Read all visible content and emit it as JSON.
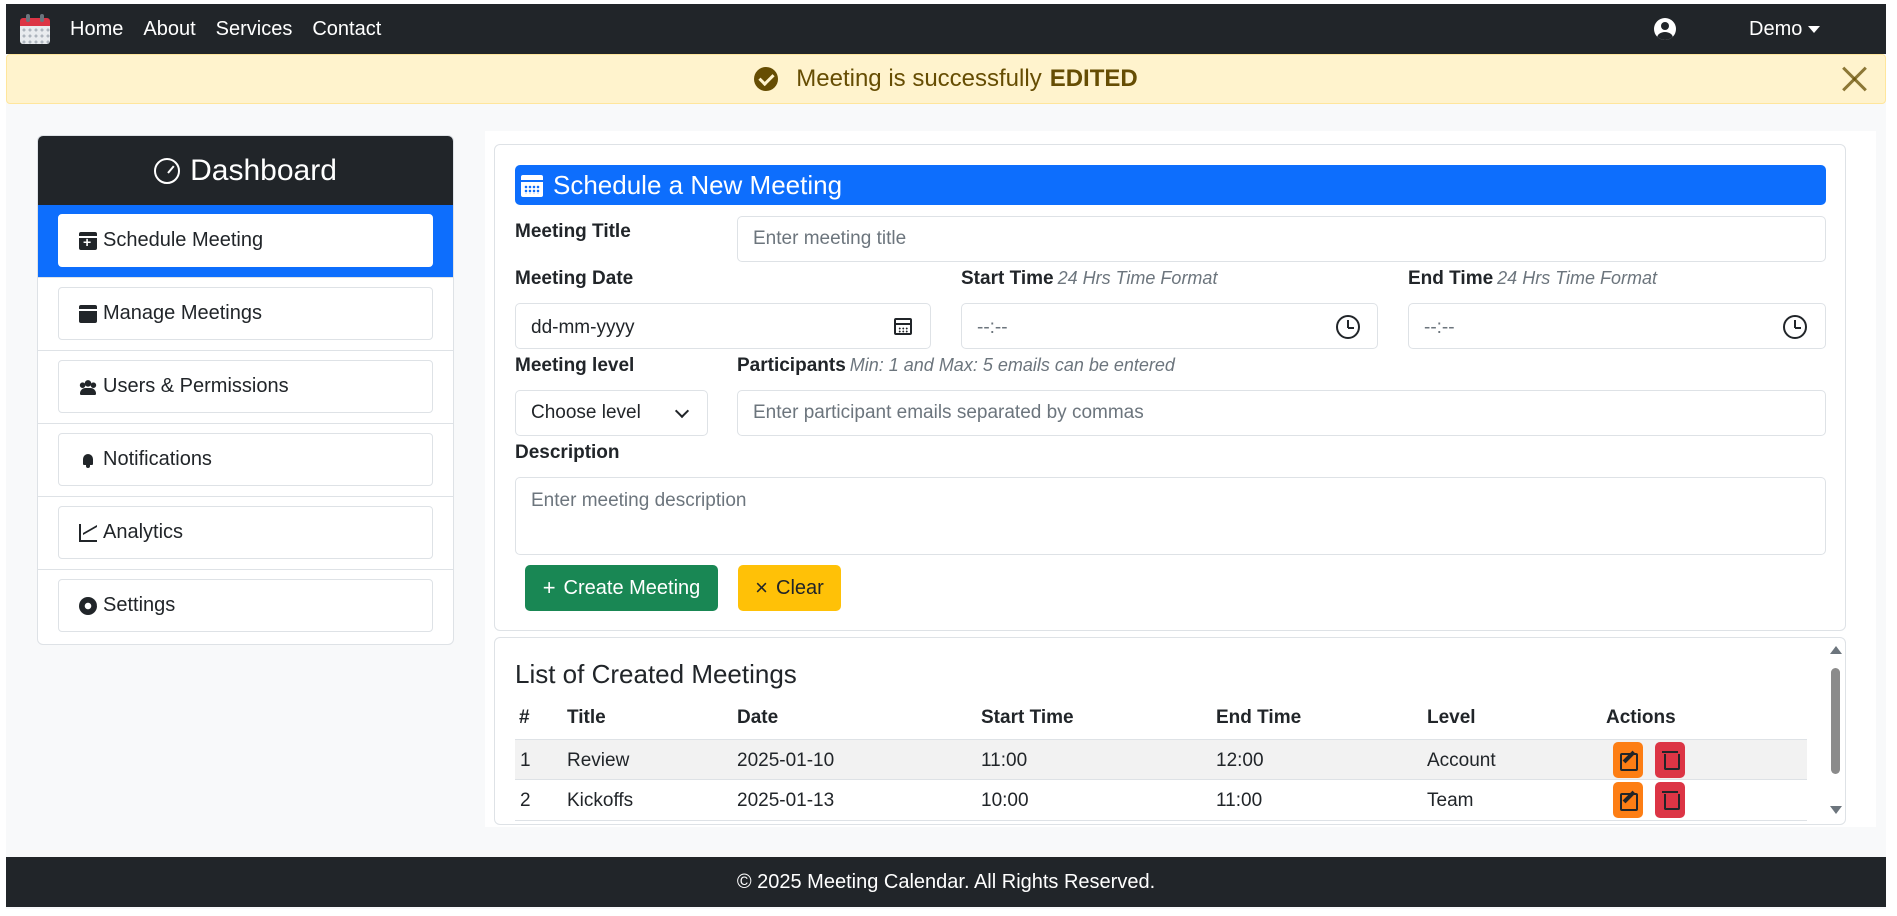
{
  "navbar": {
    "links": [
      "Home",
      "About",
      "Services",
      "Contact"
    ],
    "user_label": "Demo"
  },
  "alert": {
    "message": "Meeting is successfully",
    "emphasis": "EDITED"
  },
  "sidebar": {
    "title": "Dashboard",
    "items": [
      {
        "label": "Schedule Meeting",
        "icon": "calendar-plus-icon",
        "active": true
      },
      {
        "label": "Manage Meetings",
        "icon": "calendar-icon",
        "active": false
      },
      {
        "label": "Users & Permissions",
        "icon": "users-icon",
        "active": false
      },
      {
        "label": "Notifications",
        "icon": "bell-icon",
        "active": false
      },
      {
        "label": "Analytics",
        "icon": "chart-line-icon",
        "active": false
      },
      {
        "label": "Settings",
        "icon": "gear-icon",
        "active": false
      }
    ]
  },
  "form": {
    "header": "Schedule a New Meeting",
    "title_label": "Meeting Title",
    "title_placeholder": "Enter meeting title",
    "date_label": "Meeting Date",
    "date_value": "dd-mm-yyyy",
    "start_label": "Start Time",
    "start_hint": "24 Hrs Time Format",
    "start_value": "--:--",
    "end_label": "End Time",
    "end_hint": "24 Hrs Time Format",
    "end_value": "--:--",
    "level_label": "Meeting level",
    "level_value": "Choose level",
    "participants_label": "Participants",
    "participants_hint": "Min: 1 and Max: 5 emails can be entered",
    "participants_placeholder": "Enter participant emails separated by commas",
    "description_label": "Description",
    "description_placeholder": "Enter meeting description",
    "create_button": "Create Meeting",
    "clear_button": "Clear"
  },
  "meetings": {
    "title": "List of Created Meetings",
    "columns": [
      "#",
      "Title",
      "Date",
      "Start Time",
      "End Time",
      "Level",
      "Actions"
    ],
    "rows": [
      {
        "num": "1",
        "title": "Review",
        "date": "2025-01-10",
        "start": "11:00",
        "end": "12:00",
        "level": "Account"
      },
      {
        "num": "2",
        "title": "Kickoffs",
        "date": "2025-01-13",
        "start": "10:00",
        "end": "11:00",
        "level": "Team"
      }
    ]
  },
  "footer": {
    "text": "© 2025 Meeting Calendar. All Rights Reserved."
  },
  "colors": {
    "primary": "#0d6efd",
    "dark": "#212529",
    "success": "#198754",
    "warning": "#ffc107",
    "alert_bg": "#fff3cd",
    "edit": "#fd7e14",
    "delete": "#dc3545"
  }
}
